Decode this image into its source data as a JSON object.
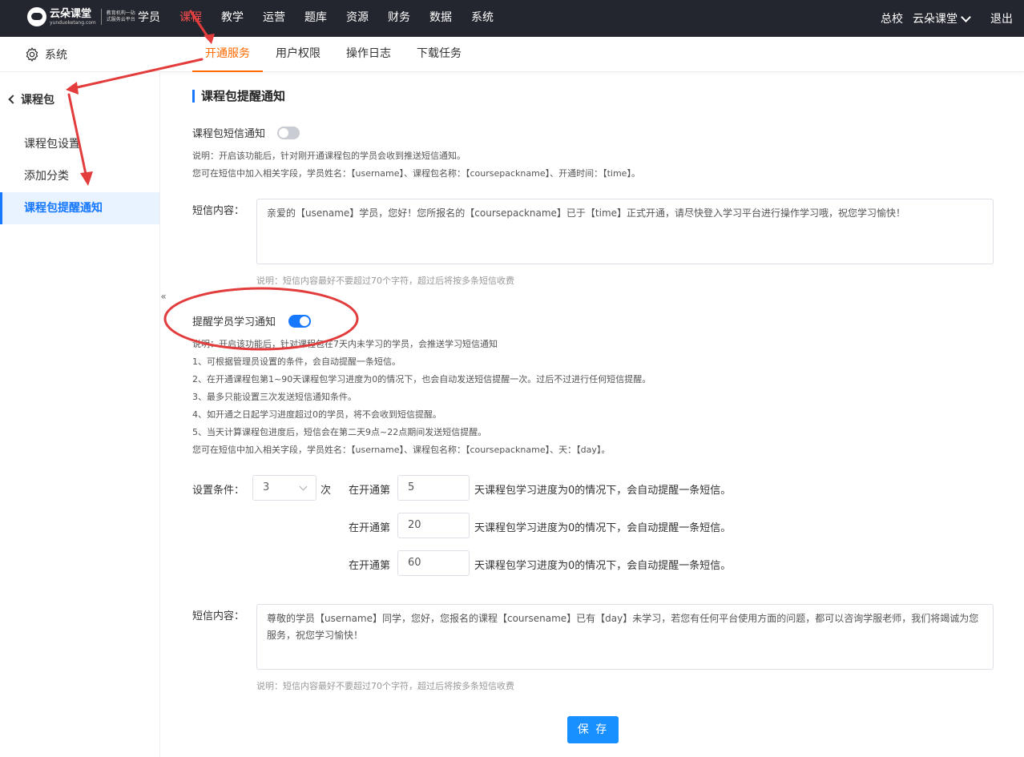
{
  "logo": {
    "name": "云朵课堂",
    "domain": "yunduoketang.com",
    "slogan": "教育机构一站式服务云平台"
  },
  "nav": {
    "items": [
      "学员",
      "课程",
      "教学",
      "运营",
      "题库",
      "资源",
      "财务",
      "数据",
      "系统"
    ],
    "active_index": 1
  },
  "top_right": {
    "campus": "总校",
    "account": "云朵课堂",
    "logout": "退出"
  },
  "subheader": {
    "section": "系统",
    "tabs": [
      "开通服务",
      "用户权限",
      "操作日志",
      "下载任务"
    ],
    "active_index": 0
  },
  "sidebar": {
    "back_label": "课程包",
    "items": [
      "课程包设置",
      "添加分类",
      "课程包提醒通知"
    ],
    "active_index": 2,
    "collapse_icon": "«"
  },
  "main": {
    "title": "课程包提醒通知",
    "sms": {
      "toggle_label": "课程包短信通知",
      "enabled": false,
      "desc1": "说明：开启该功能后，针对刚开通课程包的学员会收到推送短信通知。",
      "desc2": "您可在短信中加入相关字段，学员姓名：【username】、课程包名称：【coursepackname】、开通时间：【time】。",
      "content_label": "短信内容：",
      "content": "亲爱的【usename】学员，您好！您所报名的【coursepackname】已于【time】正式开通，请尽快登入学习平台进行操作学习哦，祝您学习愉快！",
      "hint": "说明：短信内容最好不要超过70个字符，超过后将按多条短信收费"
    },
    "reminder": {
      "toggle_label": "提醒学员学习通知",
      "enabled": true,
      "desc_lines": [
        "说明：开启该功能后，针对课程包在7天内未学习的学员，会推送学习短信通知",
        "1、可根据管理员设置的条件，会自动提醒一条短信。",
        "2、在开通课程包第1~90天课程包学习进度为0的情况下，也会自动发送短信提醒一次。过后不过进行任何短信提醒。",
        "3、最多只能设置三次发送短信通知条件。",
        "4、如开通之日起学习进度超过0的学员，将不会收到短信提醒。",
        "5、当天计算课程包进度后，短信会在第二天9点~22点期间发送短信提醒。",
        "您可在短信中加入相关字段，学员姓名：【username】、课程包名称：【coursepackname】、天：【day】。"
      ],
      "condition_label": "设置条件：",
      "condition_value": "3",
      "condition_unit": "次",
      "condition_prefix": "在开通第",
      "condition_suffix": "天课程包学习进度为0的情况下，会自动提醒一条短信。",
      "days": [
        "5",
        "20",
        "60"
      ],
      "content_label": "短信内容：",
      "content": "尊敬的学员【username】同学，您好，您报名的课程【coursename】已有【day】未学习，若您有任何平台使用方面的问题，都可以咨询学服老师，我们将竭诚为您服务，祝您学习愉快！",
      "hint": "说明：短信内容最好不要超过70个字符，超过后将按多条短信收费"
    },
    "save_label": "保 存"
  },
  "colors": {
    "topbar_bg": "#23262e",
    "nav_active": "#ff4d4f",
    "tab_active": "#ff6a00",
    "primary": "#1677ff",
    "annotation": "#e23c3c"
  },
  "icons": {
    "system": "gear-icon",
    "back": "chevron-left-icon",
    "account_menu": "chevron-down-icon",
    "select": "chevron-down-icon",
    "collapse": "double-chevron-left-icon"
  }
}
